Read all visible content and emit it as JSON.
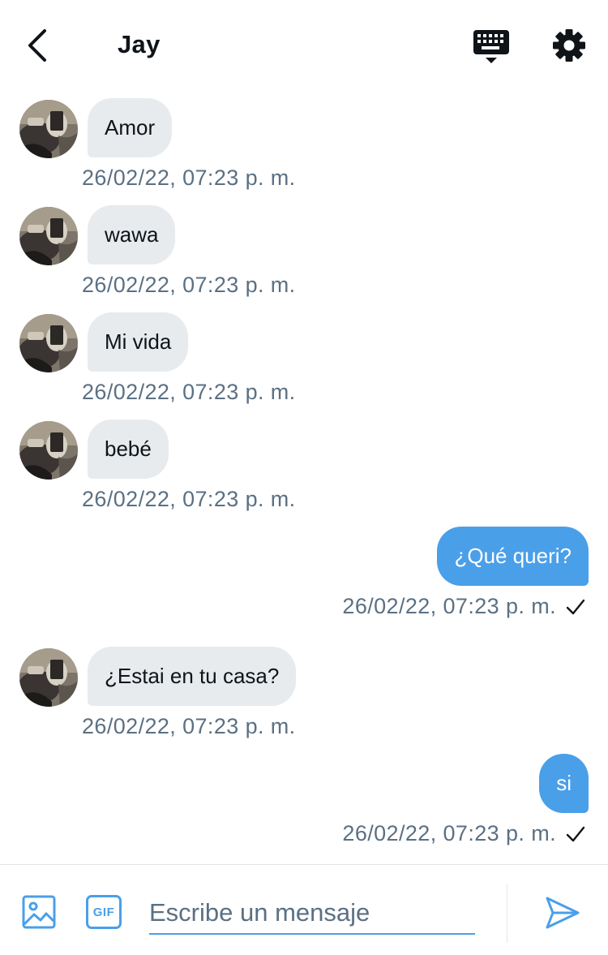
{
  "header": {
    "title": "Jay",
    "back_icon": "chevron-left-icon",
    "keyboard_icon": "keyboard-icon",
    "settings_icon": "gear-icon"
  },
  "messages": [
    {
      "direction": "in",
      "text": "Amor",
      "time": "26/02/22, 07:23 p. m."
    },
    {
      "direction": "in",
      "text": "wawa",
      "time": "26/02/22, 07:23 p. m."
    },
    {
      "direction": "in",
      "text": "Mi vida",
      "time": "26/02/22, 07:23 p. m."
    },
    {
      "direction": "in",
      "text": "bebé",
      "time": "26/02/22, 07:23 p. m."
    },
    {
      "direction": "out",
      "text": "¿Qué queri?",
      "time": "26/02/22, 07:23 p. m.",
      "status_icon": "check-icon"
    },
    {
      "direction": "in",
      "text": "¿Estai en tu casa?",
      "time": "26/02/22, 07:23 p. m."
    },
    {
      "direction": "out",
      "text": "si",
      "time": "26/02/22, 07:23 p. m.",
      "status_icon": "check-icon"
    }
  ],
  "composer": {
    "image_icon": "image-icon",
    "gif_label": "GIF",
    "placeholder": "Escribe un mensaje",
    "value": "",
    "send_icon": "send-icon"
  },
  "colors": {
    "accent": "#4a9fe9",
    "incoming_bubble": "#e7ebee",
    "timestamp": "#5b7083",
    "text": "#0f1419"
  }
}
